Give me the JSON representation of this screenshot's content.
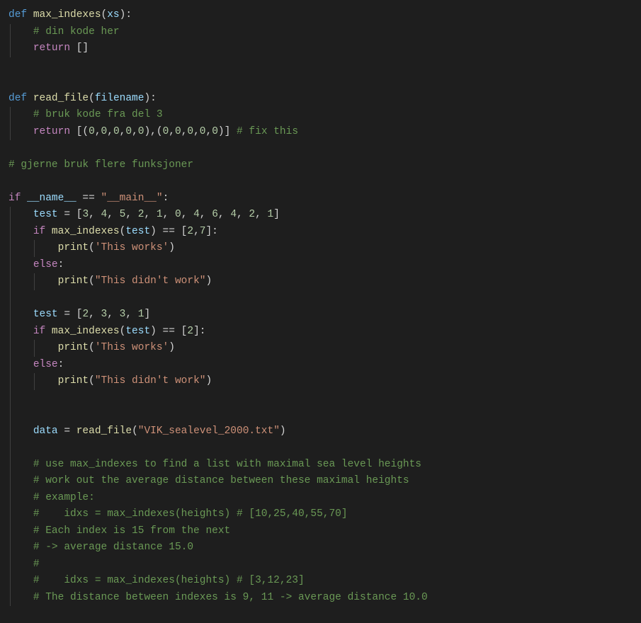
{
  "lines": [
    {
      "indent": 0,
      "guides": [],
      "tokens": [
        {
          "cls": "kw-def",
          "t": "def"
        },
        {
          "cls": "punct",
          "t": " "
        },
        {
          "cls": "fn",
          "t": "max_indexes"
        },
        {
          "cls": "punct",
          "t": "("
        },
        {
          "cls": "param",
          "t": "xs"
        },
        {
          "cls": "punct",
          "t": "):"
        }
      ]
    },
    {
      "indent": 4,
      "guides": [
        0
      ],
      "tokens": [
        {
          "cls": "comment",
          "t": "# din kode her"
        }
      ]
    },
    {
      "indent": 4,
      "guides": [
        0
      ],
      "tokens": [
        {
          "cls": "kw-ctrl",
          "t": "return"
        },
        {
          "cls": "punct",
          "t": " []"
        }
      ]
    },
    {
      "indent": 0,
      "guides": [],
      "tokens": []
    },
    {
      "indent": 0,
      "guides": [],
      "tokens": []
    },
    {
      "indent": 0,
      "guides": [],
      "tokens": [
        {
          "cls": "kw-def",
          "t": "def"
        },
        {
          "cls": "punct",
          "t": " "
        },
        {
          "cls": "fn",
          "t": "read_file"
        },
        {
          "cls": "punct",
          "t": "("
        },
        {
          "cls": "param",
          "t": "filename"
        },
        {
          "cls": "punct",
          "t": "):"
        }
      ]
    },
    {
      "indent": 4,
      "guides": [
        0
      ],
      "tokens": [
        {
          "cls": "comment",
          "t": "# bruk kode fra del 3"
        }
      ]
    },
    {
      "indent": 4,
      "guides": [
        0
      ],
      "tokens": [
        {
          "cls": "kw-ctrl",
          "t": "return"
        },
        {
          "cls": "punct",
          "t": " [("
        },
        {
          "cls": "number",
          "t": "0"
        },
        {
          "cls": "punct",
          "t": ","
        },
        {
          "cls": "number",
          "t": "0"
        },
        {
          "cls": "punct",
          "t": ","
        },
        {
          "cls": "number",
          "t": "0"
        },
        {
          "cls": "punct",
          "t": ","
        },
        {
          "cls": "number",
          "t": "0"
        },
        {
          "cls": "punct",
          "t": ","
        },
        {
          "cls": "number",
          "t": "0"
        },
        {
          "cls": "punct",
          "t": "),("
        },
        {
          "cls": "number",
          "t": "0"
        },
        {
          "cls": "punct",
          "t": ","
        },
        {
          "cls": "number",
          "t": "0"
        },
        {
          "cls": "punct",
          "t": ","
        },
        {
          "cls": "number",
          "t": "0"
        },
        {
          "cls": "punct",
          "t": ","
        },
        {
          "cls": "number",
          "t": "0"
        },
        {
          "cls": "punct",
          "t": ","
        },
        {
          "cls": "number",
          "t": "0"
        },
        {
          "cls": "punct",
          "t": ")] "
        },
        {
          "cls": "comment",
          "t": "# fix this"
        }
      ]
    },
    {
      "indent": 0,
      "guides": [],
      "tokens": []
    },
    {
      "indent": 0,
      "guides": [],
      "tokens": [
        {
          "cls": "comment",
          "t": "# gjerne bruk flere funksjoner"
        }
      ]
    },
    {
      "indent": 0,
      "guides": [],
      "tokens": []
    },
    {
      "indent": 0,
      "guides": [],
      "tokens": [
        {
          "cls": "kw-ctrl",
          "t": "if"
        },
        {
          "cls": "punct",
          "t": " "
        },
        {
          "cls": "var",
          "t": "__name__"
        },
        {
          "cls": "punct",
          "t": " == "
        },
        {
          "cls": "string",
          "t": "\"__main__\""
        },
        {
          "cls": "punct",
          "t": ":"
        }
      ]
    },
    {
      "indent": 4,
      "guides": [
        0
      ],
      "tokens": [
        {
          "cls": "var",
          "t": "test"
        },
        {
          "cls": "punct",
          "t": " = ["
        },
        {
          "cls": "number",
          "t": "3"
        },
        {
          "cls": "punct",
          "t": ", "
        },
        {
          "cls": "number",
          "t": "4"
        },
        {
          "cls": "punct",
          "t": ", "
        },
        {
          "cls": "number",
          "t": "5"
        },
        {
          "cls": "punct",
          "t": ", "
        },
        {
          "cls": "number",
          "t": "2"
        },
        {
          "cls": "punct",
          "t": ", "
        },
        {
          "cls": "number",
          "t": "1"
        },
        {
          "cls": "punct",
          "t": ", "
        },
        {
          "cls": "number",
          "t": "0"
        },
        {
          "cls": "punct",
          "t": ", "
        },
        {
          "cls": "number",
          "t": "4"
        },
        {
          "cls": "punct",
          "t": ", "
        },
        {
          "cls": "number",
          "t": "6"
        },
        {
          "cls": "punct",
          "t": ", "
        },
        {
          "cls": "number",
          "t": "4"
        },
        {
          "cls": "punct",
          "t": ", "
        },
        {
          "cls": "number",
          "t": "2"
        },
        {
          "cls": "punct",
          "t": ", "
        },
        {
          "cls": "number",
          "t": "1"
        },
        {
          "cls": "punct",
          "t": "]"
        }
      ]
    },
    {
      "indent": 4,
      "guides": [
        0
      ],
      "tokens": [
        {
          "cls": "kw-ctrl",
          "t": "if"
        },
        {
          "cls": "punct",
          "t": " "
        },
        {
          "cls": "fn",
          "t": "max_indexes"
        },
        {
          "cls": "punct",
          "t": "("
        },
        {
          "cls": "var",
          "t": "test"
        },
        {
          "cls": "punct",
          "t": ") == ["
        },
        {
          "cls": "number",
          "t": "2"
        },
        {
          "cls": "punct",
          "t": ","
        },
        {
          "cls": "number",
          "t": "7"
        },
        {
          "cls": "punct",
          "t": "]:"
        }
      ]
    },
    {
      "indent": 8,
      "guides": [
        0,
        4
      ],
      "tokens": [
        {
          "cls": "fn",
          "t": "print"
        },
        {
          "cls": "punct",
          "t": "("
        },
        {
          "cls": "string",
          "t": "'This works'"
        },
        {
          "cls": "punct",
          "t": ")"
        }
      ]
    },
    {
      "indent": 4,
      "guides": [
        0
      ],
      "tokens": [
        {
          "cls": "kw-ctrl",
          "t": "else"
        },
        {
          "cls": "punct",
          "t": ":"
        }
      ]
    },
    {
      "indent": 8,
      "guides": [
        0,
        4
      ],
      "tokens": [
        {
          "cls": "fn",
          "t": "print"
        },
        {
          "cls": "punct",
          "t": "("
        },
        {
          "cls": "string",
          "t": "\"This didn't work\""
        },
        {
          "cls": "punct",
          "t": ")"
        }
      ]
    },
    {
      "indent": 0,
      "guides": [
        0
      ],
      "tokens": []
    },
    {
      "indent": 4,
      "guides": [
        0
      ],
      "tokens": [
        {
          "cls": "var",
          "t": "test"
        },
        {
          "cls": "punct",
          "t": " = ["
        },
        {
          "cls": "number",
          "t": "2"
        },
        {
          "cls": "punct",
          "t": ", "
        },
        {
          "cls": "number",
          "t": "3"
        },
        {
          "cls": "punct",
          "t": ", "
        },
        {
          "cls": "number",
          "t": "3"
        },
        {
          "cls": "punct",
          "t": ", "
        },
        {
          "cls": "number",
          "t": "1"
        },
        {
          "cls": "punct",
          "t": "]"
        }
      ]
    },
    {
      "indent": 4,
      "guides": [
        0
      ],
      "tokens": [
        {
          "cls": "kw-ctrl",
          "t": "if"
        },
        {
          "cls": "punct",
          "t": " "
        },
        {
          "cls": "fn",
          "t": "max_indexes"
        },
        {
          "cls": "punct",
          "t": "("
        },
        {
          "cls": "var",
          "t": "test"
        },
        {
          "cls": "punct",
          "t": ") == ["
        },
        {
          "cls": "number",
          "t": "2"
        },
        {
          "cls": "punct",
          "t": "]:"
        }
      ]
    },
    {
      "indent": 8,
      "guides": [
        0,
        4
      ],
      "tokens": [
        {
          "cls": "fn",
          "t": "print"
        },
        {
          "cls": "punct",
          "t": "("
        },
        {
          "cls": "string",
          "t": "'This works'"
        },
        {
          "cls": "punct",
          "t": ")"
        }
      ]
    },
    {
      "indent": 4,
      "guides": [
        0
      ],
      "tokens": [
        {
          "cls": "kw-ctrl",
          "t": "else"
        },
        {
          "cls": "punct",
          "t": ":"
        }
      ]
    },
    {
      "indent": 8,
      "guides": [
        0,
        4
      ],
      "tokens": [
        {
          "cls": "fn",
          "t": "print"
        },
        {
          "cls": "punct",
          "t": "("
        },
        {
          "cls": "string",
          "t": "\"This didn't work\""
        },
        {
          "cls": "punct",
          "t": ")"
        }
      ]
    },
    {
      "indent": 0,
      "guides": [
        0
      ],
      "tokens": []
    },
    {
      "indent": 0,
      "guides": [
        0
      ],
      "tokens": []
    },
    {
      "indent": 4,
      "guides": [
        0
      ],
      "tokens": [
        {
          "cls": "var",
          "t": "data"
        },
        {
          "cls": "punct",
          "t": " = "
        },
        {
          "cls": "fn",
          "t": "read_file"
        },
        {
          "cls": "punct",
          "t": "("
        },
        {
          "cls": "string",
          "t": "\"VIK_sealevel_2000.txt\""
        },
        {
          "cls": "punct",
          "t": ")"
        }
      ]
    },
    {
      "indent": 0,
      "guides": [
        0
      ],
      "tokens": []
    },
    {
      "indent": 4,
      "guides": [
        0
      ],
      "tokens": [
        {
          "cls": "comment",
          "t": "# use max_indexes to find a list with maximal sea level heights"
        }
      ]
    },
    {
      "indent": 4,
      "guides": [
        0
      ],
      "tokens": [
        {
          "cls": "comment",
          "t": "# work out the average distance between these maximal heights"
        }
      ]
    },
    {
      "indent": 4,
      "guides": [
        0
      ],
      "tokens": [
        {
          "cls": "comment",
          "t": "# example:"
        }
      ]
    },
    {
      "indent": 4,
      "guides": [
        0
      ],
      "tokens": [
        {
          "cls": "comment",
          "t": "#    idxs = max_indexes(heights) # [10,25,40,55,70]"
        }
      ]
    },
    {
      "indent": 4,
      "guides": [
        0
      ],
      "tokens": [
        {
          "cls": "comment",
          "t": "# Each index is 15 from the next"
        }
      ]
    },
    {
      "indent": 4,
      "guides": [
        0
      ],
      "tokens": [
        {
          "cls": "comment",
          "t": "# -> average distance 15.0"
        }
      ]
    },
    {
      "indent": 4,
      "guides": [
        0
      ],
      "tokens": [
        {
          "cls": "comment",
          "t": "#"
        }
      ]
    },
    {
      "indent": 4,
      "guides": [
        0
      ],
      "tokens": [
        {
          "cls": "comment",
          "t": "#    idxs = max_indexes(heights) # [3,12,23]"
        }
      ]
    },
    {
      "indent": 4,
      "guides": [
        0
      ],
      "tokens": [
        {
          "cls": "comment",
          "t": "# The distance between indexes is 9, 11 -> average distance 10.0"
        }
      ]
    }
  ]
}
